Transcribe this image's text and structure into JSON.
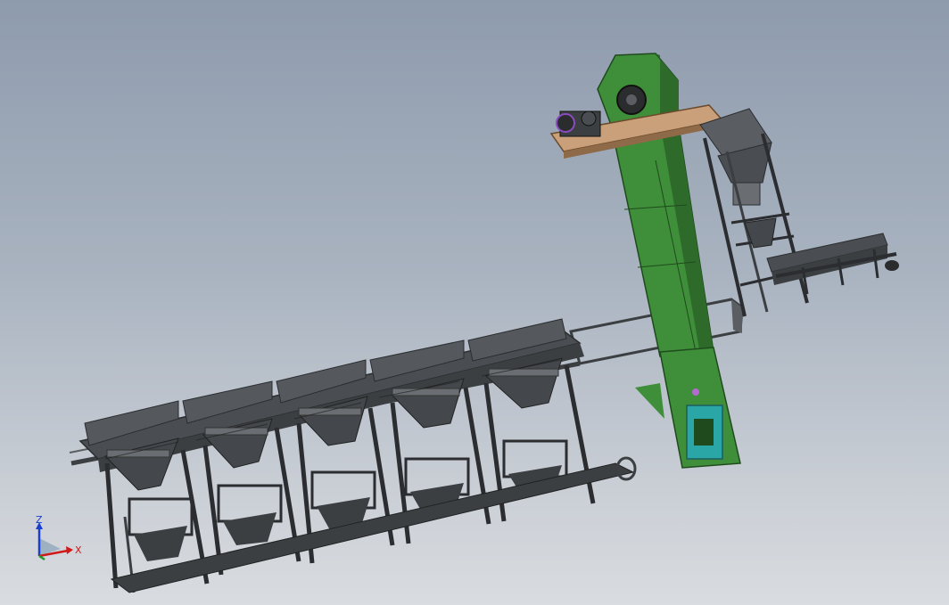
{
  "viewport": {
    "background_top": "#8e9bad",
    "background_bottom": "#d9dce0"
  },
  "model": {
    "colors": {
      "frame": "#3c3f42",
      "frame_light": "#5a5e62",
      "hopper": "#4a4e52",
      "elevator_green": "#3f8f3a",
      "elevator_dark": "#2e6b2b",
      "platform_wood": "#b8906a",
      "motor_cyan": "#2aa6a6"
    }
  },
  "triad": {
    "z_label": "Z",
    "x_label": "X",
    "z_color": "#1a3fd0",
    "x_color": "#d01a1a",
    "y_color": "#1a9a2a"
  }
}
